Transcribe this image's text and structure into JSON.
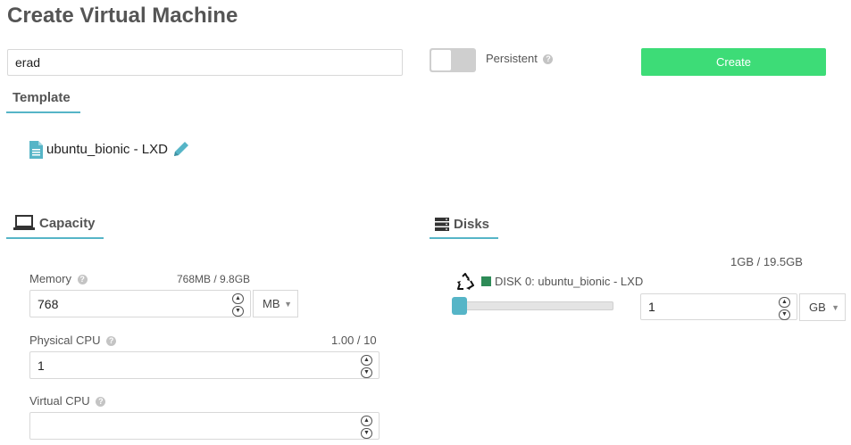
{
  "page": {
    "title": "Create Virtual Machine"
  },
  "vm_name": {
    "value": "erad"
  },
  "persistent": {
    "label": "Persistent",
    "enabled": false
  },
  "create_button": {
    "label": "Create"
  },
  "template": {
    "tab_label": "Template",
    "name": "ubuntu_bionic - LXD"
  },
  "capacity": {
    "tab_label": "Capacity",
    "memory": {
      "label": "Memory",
      "usage": "768MB / 9.8GB",
      "value": "768",
      "unit": "MB"
    },
    "physical_cpu": {
      "label": "Physical CPU",
      "usage": "1.00 / 10",
      "value": "1"
    },
    "virtual_cpu": {
      "label": "Virtual CPU",
      "value": ""
    }
  },
  "disks": {
    "tab_label": "Disks",
    "usage": "1GB / 19.5GB",
    "disk0": {
      "label": "DISK 0: ubuntu_bionic - LXD",
      "color": "#2e8b57",
      "value": "1",
      "unit": "GB",
      "slider_level_fraction": 0.0
    }
  },
  "colors": {
    "accent": "#56b5c7",
    "create": "#3ddc77"
  },
  "icons": {
    "help": "question-circle-icon",
    "template": "file-icon",
    "edit": "pencil-icon",
    "capacity": "laptop-icon",
    "disks": "server-icon",
    "recycle": "recycle-icon"
  }
}
